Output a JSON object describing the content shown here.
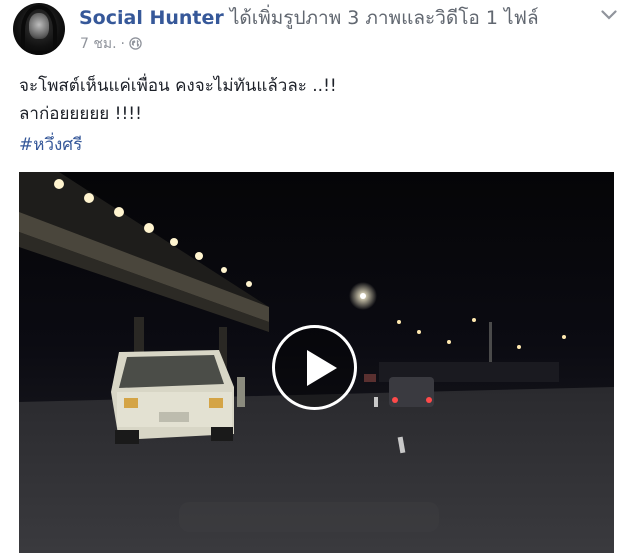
{
  "post": {
    "author": "Social Hunter",
    "action": "ได้เพิ่มรูปภาพ 3 ภาพและวิดีโอ 1 ไฟล์",
    "time": "7 ชม.",
    "text_line1": "จะโพสต์เห็นแค่เพื่อน คงจะไม่ทันแล้วละ ..!!",
    "text_line2": "ลาก่อยยยยย !!!!",
    "hashtag": "#หวึ่งศรี"
  },
  "icons": {
    "globe": "globe-icon",
    "chevron": "chevron-down-icon",
    "play": "play-icon"
  },
  "colors": {
    "link": "#365899",
    "muted": "#90949c",
    "text": "#1d2129"
  }
}
